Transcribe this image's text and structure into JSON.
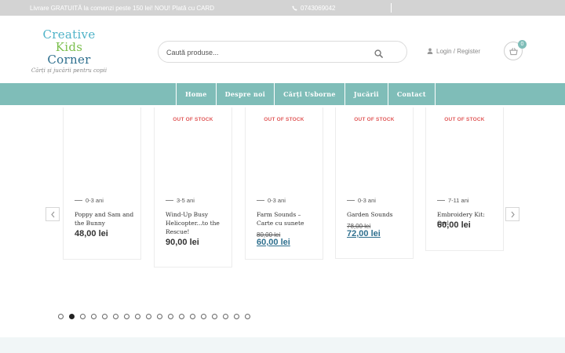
{
  "topbar": {
    "promo": "Livrare GRATUITĂ la comenzi peste 150 lei! NOU! Plată cu CARD",
    "phone": "0743069042"
  },
  "logo": {
    "line1": "Creative",
    "line2": "Kids",
    "line3": "Corner",
    "tagline": "Cărți și jucării pentru copii"
  },
  "search": {
    "placeholder": "Caută produse..."
  },
  "account": {
    "login_label": "Login / Register"
  },
  "cart": {
    "count": "0"
  },
  "nav": {
    "items": [
      {
        "label": "Home"
      },
      {
        "label": "Despre noi"
      },
      {
        "label": "Cărți Usborne"
      },
      {
        "label": "Jucării"
      },
      {
        "label": "Contact"
      }
    ]
  },
  "products": [
    {
      "stock": "",
      "age": "0-3 ani",
      "title": "Poppy and Sam and the Bunny",
      "old_price": "",
      "price": "48,00 lei"
    },
    {
      "stock": "OUT OF STOCK",
      "age": "3-5 ani",
      "title": "Wind-Up Busy Helicopter...to the Rescue!",
      "old_price": "",
      "price": "90,00 lei"
    },
    {
      "stock": "OUT OF STOCK",
      "age": "0-3 ani",
      "title": "Farm Sounds – Carte cu sunete",
      "old_price": "80,00 lei",
      "price": "60,00 lei"
    },
    {
      "stock": "OUT OF STOCK",
      "age": "0-3 ani",
      "title": "Garden Sounds",
      "old_price": "78,00 lei",
      "price": "72,00 lei"
    },
    {
      "stock": "OUT OF STOCK",
      "age": "7-11 ani",
      "title": "Embroidery Kit: Owl",
      "old_price": "",
      "price": "60,00 lei"
    }
  ],
  "pagination": {
    "total": 18,
    "active": 2
  },
  "colors": {
    "nav_bg": "#7fbdb8",
    "topbar_bg": "#d3d3d3",
    "out_of_stock": "#e05757",
    "sale_price": "#2e6f8e"
  }
}
